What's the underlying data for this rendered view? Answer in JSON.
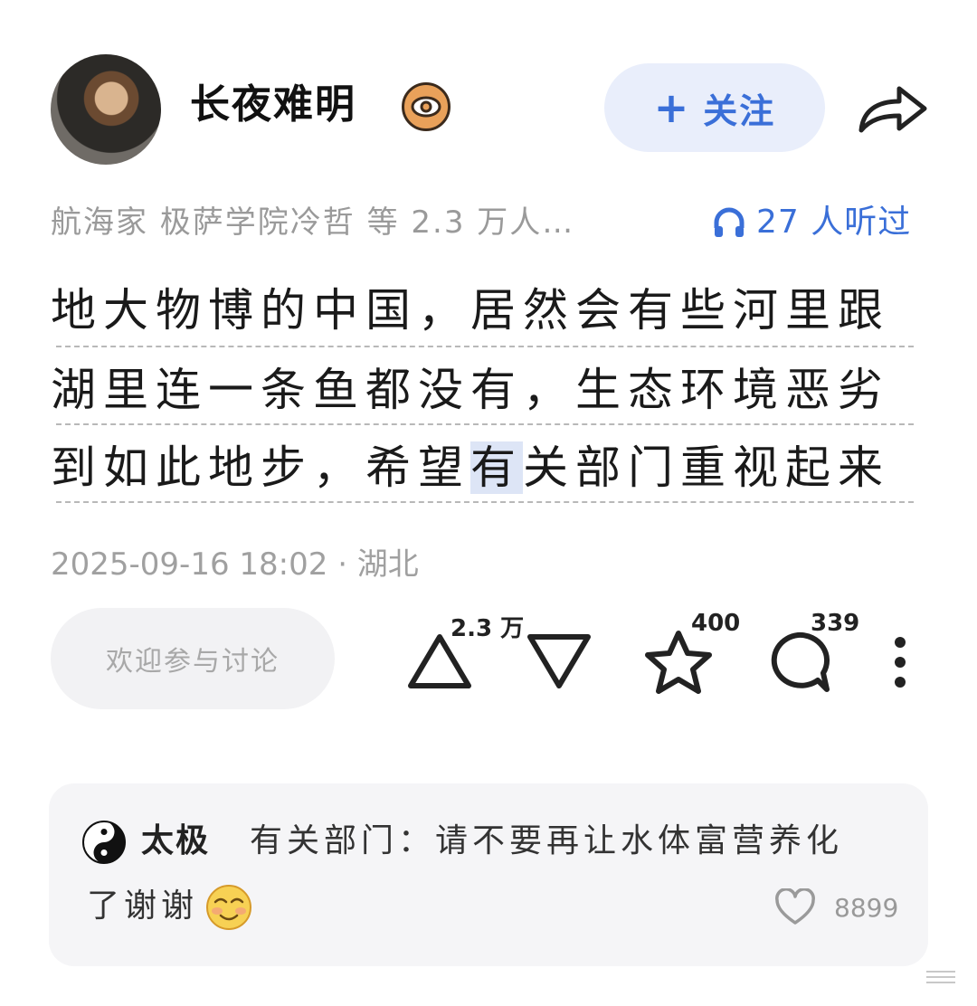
{
  "author": {
    "name": "长夜难明",
    "badge_icon": "eye-icon",
    "follow_label": "关注",
    "follow_icon": "plus-icon",
    "share_icon": "share-arrow-icon"
  },
  "meta": {
    "followers_text": "航海家 极萨学院冷哲 等 2.3 万人…",
    "listeners_text": "27 人听过",
    "listeners_icon": "headphones-icon"
  },
  "post": {
    "lines": [
      "地大物博的中国，居然会有些河里跟",
      "湖里连一条鱼都没有，生态环境恶劣"
    ],
    "line3_before": "到如此地步，希望",
    "line3_highlight": "有",
    "line3_after": "关部门重视起来",
    "timestamp": "2025-09-16 18:02 · 湖北"
  },
  "actions": {
    "discuss_placeholder": "欢迎参与讨论",
    "upvote_count": "2.3 万",
    "favorite_count": "400",
    "comment_count": "339"
  },
  "comment": {
    "author": "太极",
    "line1": "有关部门：请不要再让水体富营养化",
    "line2": "了谢谢",
    "emoji": "smile-emoji",
    "like_count": "8899"
  },
  "colors": {
    "accent": "#3a6fd8",
    "muted": "#9a9a9a",
    "highlight": "#dde5f6"
  }
}
